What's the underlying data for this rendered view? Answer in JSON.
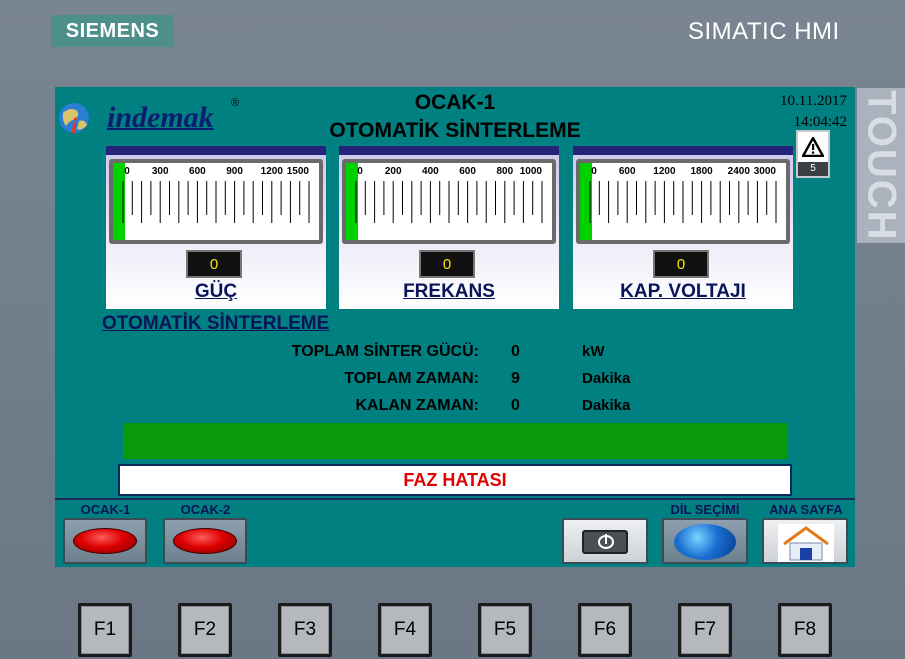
{
  "panel": {
    "brand": "SIEMENS",
    "model": "SIMATIC HMI",
    "touch": "TOUCH"
  },
  "screen": {
    "logo": {
      "name": "indemak",
      "reg": "®"
    },
    "title_line1": "OCAK-1",
    "title_line2": "OTOMATİK SİNTERLEME",
    "date": "10.11.2017",
    "time": "14:04:42",
    "alarm_count": "5"
  },
  "gauges": [
    {
      "label": "GÜÇ",
      "value": "0",
      "ticks": [
        "0",
        "300",
        "600",
        "900",
        "1200",
        "1500"
      ],
      "fill_fraction": 0.0
    },
    {
      "label": "FREKANS",
      "value": "0",
      "ticks": [
        "0",
        "200",
        "400",
        "600",
        "800",
        "1000"
      ],
      "fill_fraction": 0.0
    },
    {
      "label": "KAP. VOLTAJI",
      "value": "0",
      "ticks": [
        "0",
        "600",
        "1200",
        "1800",
        "2400",
        "3000"
      ],
      "fill_fraction": 0.0
    }
  ],
  "auto": {
    "title": "OTOMATİK SİNTERLEME",
    "rows": [
      {
        "label": "TOPLAM SİNTER GÜCÜ:",
        "value": "0",
        "unit": "kW"
      },
      {
        "label": "TOPLAM ZAMAN:",
        "value": "9",
        "unit": "Dakika"
      },
      {
        "label": "KALAN ZAMAN:",
        "value": "0",
        "unit": "Dakika"
      }
    ],
    "progress_fraction": 1.0,
    "message": "FAZ HATASI"
  },
  "buttons": {
    "ocak1": "OCAK-1",
    "ocak2": "OCAK-2",
    "language": "DİL SEÇİMİ",
    "home": "ANA SAYFA"
  },
  "fkeys": [
    "F1",
    "F2",
    "F3",
    "F4",
    "F5",
    "F6",
    "F7",
    "F8"
  ],
  "colors": {
    "screen_bg": "#008080",
    "gauge_fill": "#00d200",
    "progress": "#0a9a0a",
    "message_text": "#e00000",
    "value_text": "#ffe800"
  }
}
